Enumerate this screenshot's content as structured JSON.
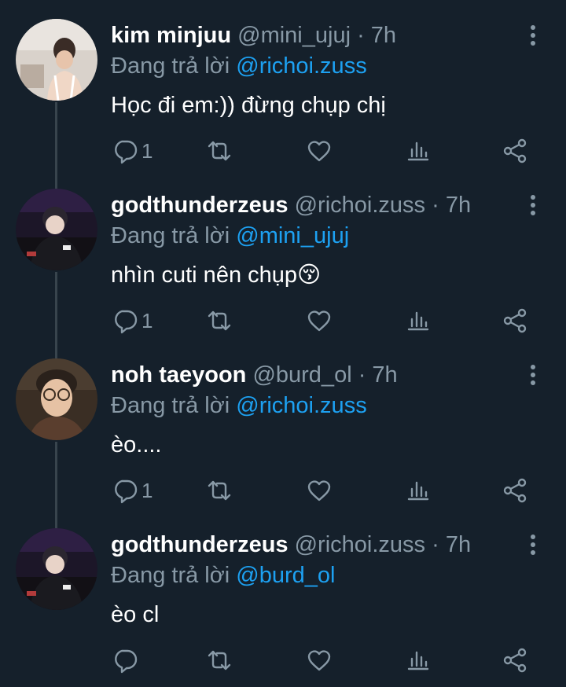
{
  "tweets": [
    {
      "name": "kim minjuu",
      "handle": "@mini_ujuj",
      "time": "· 7h",
      "reply_prefix": "Đang trả lời",
      "reply_to": "@richoi.zuss",
      "text": "Học đi em:)) đừng chụp chị",
      "reply_count": "1",
      "avatar_icon": "avatar-photo"
    },
    {
      "name": "godthunderzeus",
      "handle": "@richoi.zuss",
      "time": "· 7h",
      "reply_prefix": "Đang trả lời",
      "reply_to": "@mini_ujuj",
      "text": "nhìn cuti nên chụp😚",
      "reply_count": "1",
      "avatar_icon": "avatar-photo"
    },
    {
      "name": "noh taeyoon",
      "handle": "@burd_ol",
      "time": "· 7h",
      "reply_prefix": "Đang trả lời",
      "reply_to": "@richoi.zuss",
      "text": "èo....",
      "reply_count": "1",
      "avatar_icon": "avatar-photo"
    },
    {
      "name": "godthunderzeus",
      "handle": "@richoi.zuss",
      "time": "· 7h",
      "reply_prefix": "Đang trả lời",
      "reply_to": "@burd_ol",
      "text": "èo cl",
      "reply_count": "",
      "avatar_icon": "avatar-photo"
    }
  ],
  "colors": {
    "background": "#15202b",
    "text": "#ffffff",
    "muted": "#8899a6",
    "accent": "#1da1f2",
    "thread_line": "#38444d"
  },
  "icons": [
    "more-icon",
    "reply-icon",
    "retweet-icon",
    "like-icon",
    "stats-icon",
    "share-icon"
  ]
}
